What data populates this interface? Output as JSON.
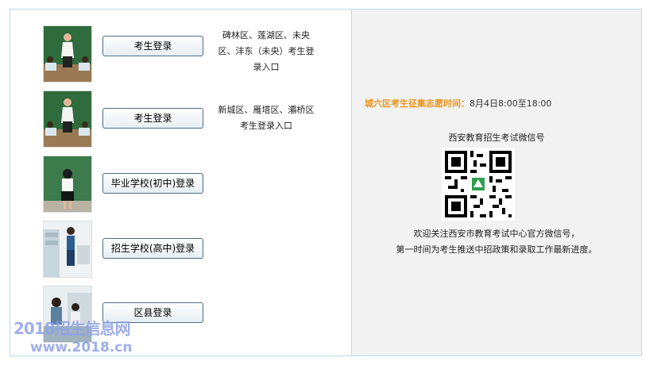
{
  "rows": [
    {
      "button": "考生登录",
      "desc_lines": [
        "碑林区、莲湖区、未央",
        "区、沣东（未央）考生登",
        "录入口"
      ],
      "photo": "teacher-at-blackboard"
    },
    {
      "button": "考生登录",
      "desc_lines": [
        "新城区、雁塔区、灞桥区",
        "考生登录入口"
      ],
      "photo": "teacher-at-blackboard"
    },
    {
      "button": "毕业学校(初中)登录",
      "desc_lines": [],
      "photo": "student-facing-blackboard"
    },
    {
      "button": "招生学校(高中)登录",
      "desc_lines": [],
      "photo": "office-woman"
    },
    {
      "button": "区县登录",
      "desc_lines": [],
      "photo": "office-women"
    }
  ],
  "right": {
    "deadline_label": "城六区考生征集志愿时间：",
    "deadline_value": "8月4日8:00至18:00",
    "wechat_title": "西安教育招生考试微信号",
    "qr_icon": "qr-code-icon",
    "note_line1": "欢迎关注西安市教育考试中心官方微信号，",
    "note_line2": "第一时间为考生推送中招政策和录取工作最新进度。"
  },
  "watermark": {
    "line1": "2018招生信息网",
    "line2": "www.2018.cn"
  },
  "colors": {
    "border": "#b7dcef",
    "accent": "#e8941a",
    "panel": "#f2f2f2",
    "watermark": "#8ea2e6"
  }
}
